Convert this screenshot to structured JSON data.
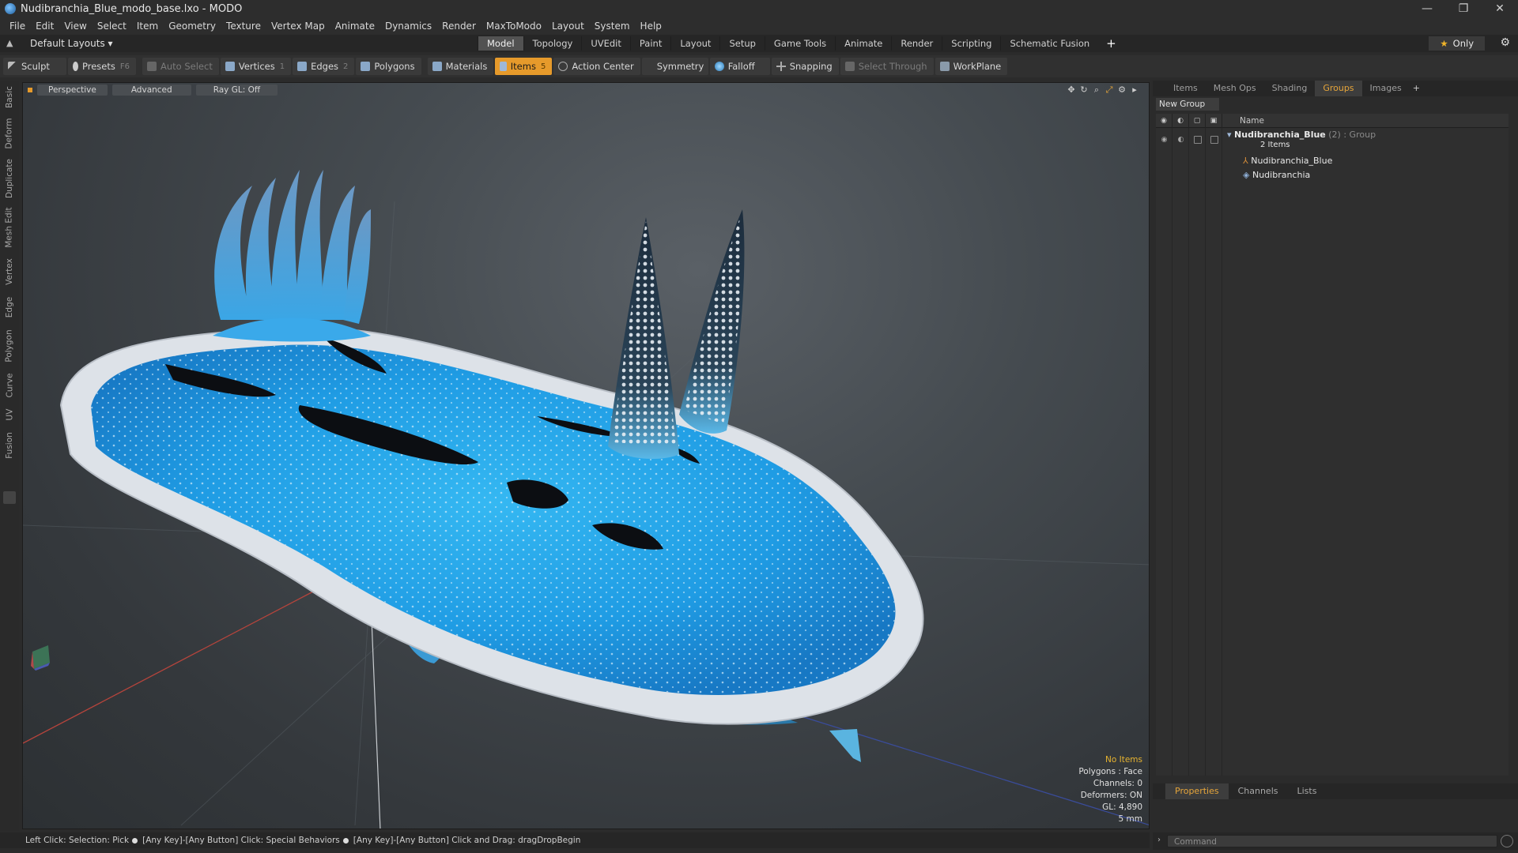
{
  "window": {
    "title": "Nudibranchia_Blue_modo_base.lxo - MODO",
    "controls": [
      "—",
      "❐",
      "✕"
    ]
  },
  "menu": [
    "File",
    "Edit",
    "View",
    "Select",
    "Item",
    "Geometry",
    "Texture",
    "Vertex Map",
    "Animate",
    "Dynamics",
    "Render",
    "MaxToModo",
    "Layout",
    "System",
    "Help"
  ],
  "layout_bar": {
    "layout_select": "Default Layouts ▾",
    "tabs": [
      "Model",
      "Topology",
      "UVEdit",
      "Paint",
      "Layout",
      "Setup",
      "Game Tools",
      "Animate",
      "Render",
      "Scripting",
      "Schematic Fusion"
    ],
    "active_tab": "Model",
    "only_label": "Only"
  },
  "toolbar": {
    "sculpt": "Sculpt",
    "presets": "Presets",
    "presets_key": "F6",
    "auto_select": "Auto Select",
    "vertices": "Vertices",
    "vertices_key": "1",
    "edges": "Edges",
    "edges_key": "2",
    "polygons": "Polygons",
    "materials": "Materials",
    "items": "Items",
    "items_key": "5",
    "action_center": "Action Center",
    "symmetry": "Symmetry",
    "falloff": "Falloff",
    "snapping": "Snapping",
    "select_through": "Select Through",
    "workplane": "WorkPlane"
  },
  "left_tabs": [
    "Basic",
    "Deform",
    "Duplicate",
    "Mesh Edit",
    "Vertex",
    "Edge",
    "Polygon",
    "Curve",
    "UV",
    "Fusion"
  ],
  "viewport": {
    "view_mode": "Perspective",
    "shading": "Advanced",
    "raygl": "Ray GL: Off",
    "info": {
      "no_items": "No Items",
      "polygons": "Polygons : Face",
      "channels": "Channels: 0",
      "deformers": "Deformers: ON",
      "gl": "GL: 4,890",
      "unit": "5 mm"
    }
  },
  "status_bar": {
    "part1": "Left Click: Selection: Pick",
    "part2": "[Any Key]-[Any Button] Click: Special Behaviors",
    "part3": "[Any Key]-[Any Button] Click and Drag: dragDropBegin"
  },
  "right_panel": {
    "tabs": [
      "Items",
      "Mesh Ops",
      "Shading",
      "Groups",
      "Images"
    ],
    "active_tab": "Groups",
    "new_group": "New Group",
    "column_name": "Name",
    "rows": [
      {
        "name": "Nudibranchia_Blue",
        "count": "(2)",
        "type": ": Group",
        "sub": "2 Items"
      },
      {
        "name": "Nudibranchia_Blue"
      },
      {
        "name": "Nudibranchia"
      }
    ]
  },
  "properties_tabs": [
    "Properties",
    "Channels",
    "Lists"
  ],
  "command": {
    "placeholder": "Command"
  },
  "colors": {
    "accent": "#e69a2b",
    "slug_blue": "#2aa8ec",
    "slug_edge": "#e4e8ee"
  }
}
